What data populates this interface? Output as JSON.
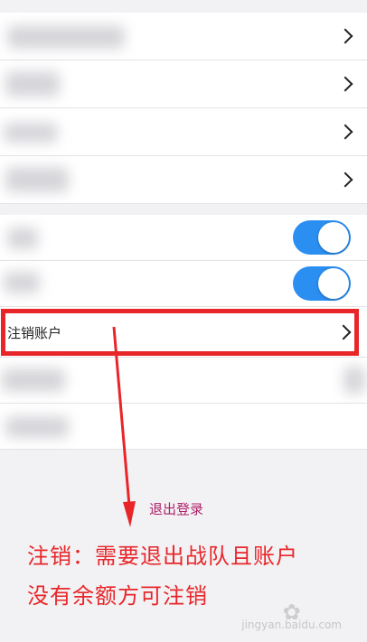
{
  "settings": {
    "cancel_account_label": "注销账户"
  },
  "annotations": {
    "logout_label": "退出登录",
    "note_line1": "注销：需要退出战队且账户",
    "note_line2": "没有余额方可注销"
  },
  "watermark": {
    "site": "jingyan.baidu.com"
  },
  "colors": {
    "toggle_on": "#2b8ff2",
    "highlight": "#e8262a",
    "annotation_small": "#b0206a"
  }
}
